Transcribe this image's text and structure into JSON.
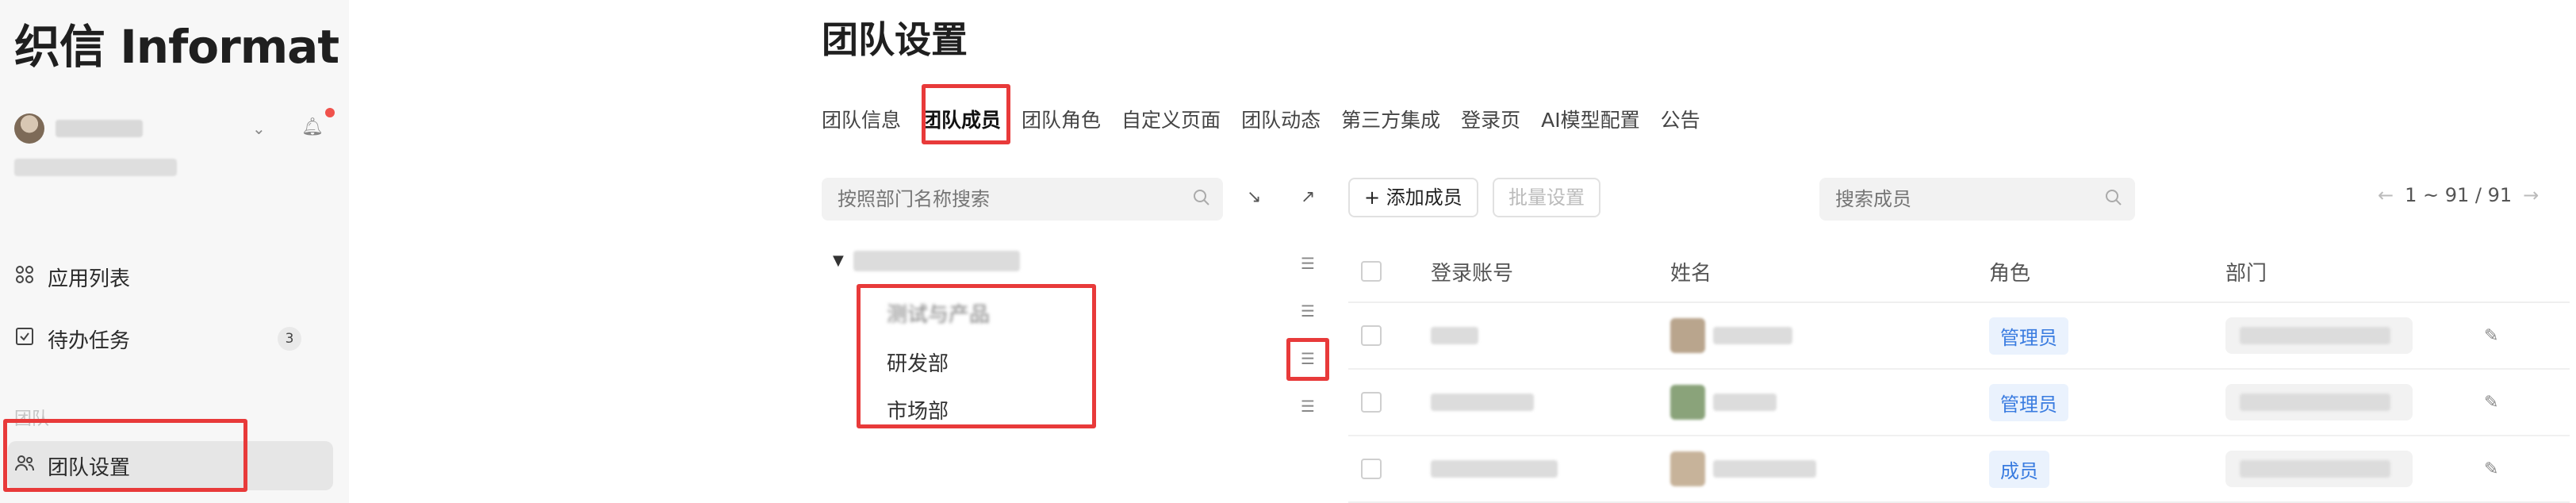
{
  "app": {
    "logo": "织信 Informat"
  },
  "sidebar": {
    "nav": [
      {
        "label": "应用列表",
        "icon": "grid-icon"
      },
      {
        "label": "待办任务",
        "icon": "checkbox-icon",
        "badge": "3"
      }
    ],
    "section_label": "团队",
    "active_item": {
      "label": "团队设置",
      "icon": "team-icon"
    }
  },
  "main": {
    "title": "团队设置",
    "tabs": [
      {
        "label": "团队信息"
      },
      {
        "label": "团队成员",
        "active": true
      },
      {
        "label": "团队角色"
      },
      {
        "label": "自定义页面"
      },
      {
        "label": "团队动态"
      },
      {
        "label": "第三方集成"
      },
      {
        "label": "登录页"
      },
      {
        "label": "AI模型配置"
      },
      {
        "label": "公告"
      }
    ],
    "dept_search_placeholder": "按照部门名称搜索",
    "departments": [
      {
        "label": "测试与产品"
      },
      {
        "label": "研发部"
      },
      {
        "label": "市场部"
      }
    ],
    "add_member_label": "+ 添加成员",
    "batch_label": "批量设置",
    "member_search_placeholder": "搜索成员",
    "pager_text": "1 ~ 91 / 91",
    "table": {
      "headers": [
        "登录账号",
        "姓名",
        "角色",
        "部门"
      ],
      "rows": [
        {
          "role": "管理员"
        },
        {
          "role": "管理员"
        },
        {
          "role": "成员"
        }
      ]
    }
  },
  "colors": {
    "highlight": "#e83a3a",
    "role_tag_text": "#3a7ce0",
    "notification_dot": "#f0524c"
  }
}
